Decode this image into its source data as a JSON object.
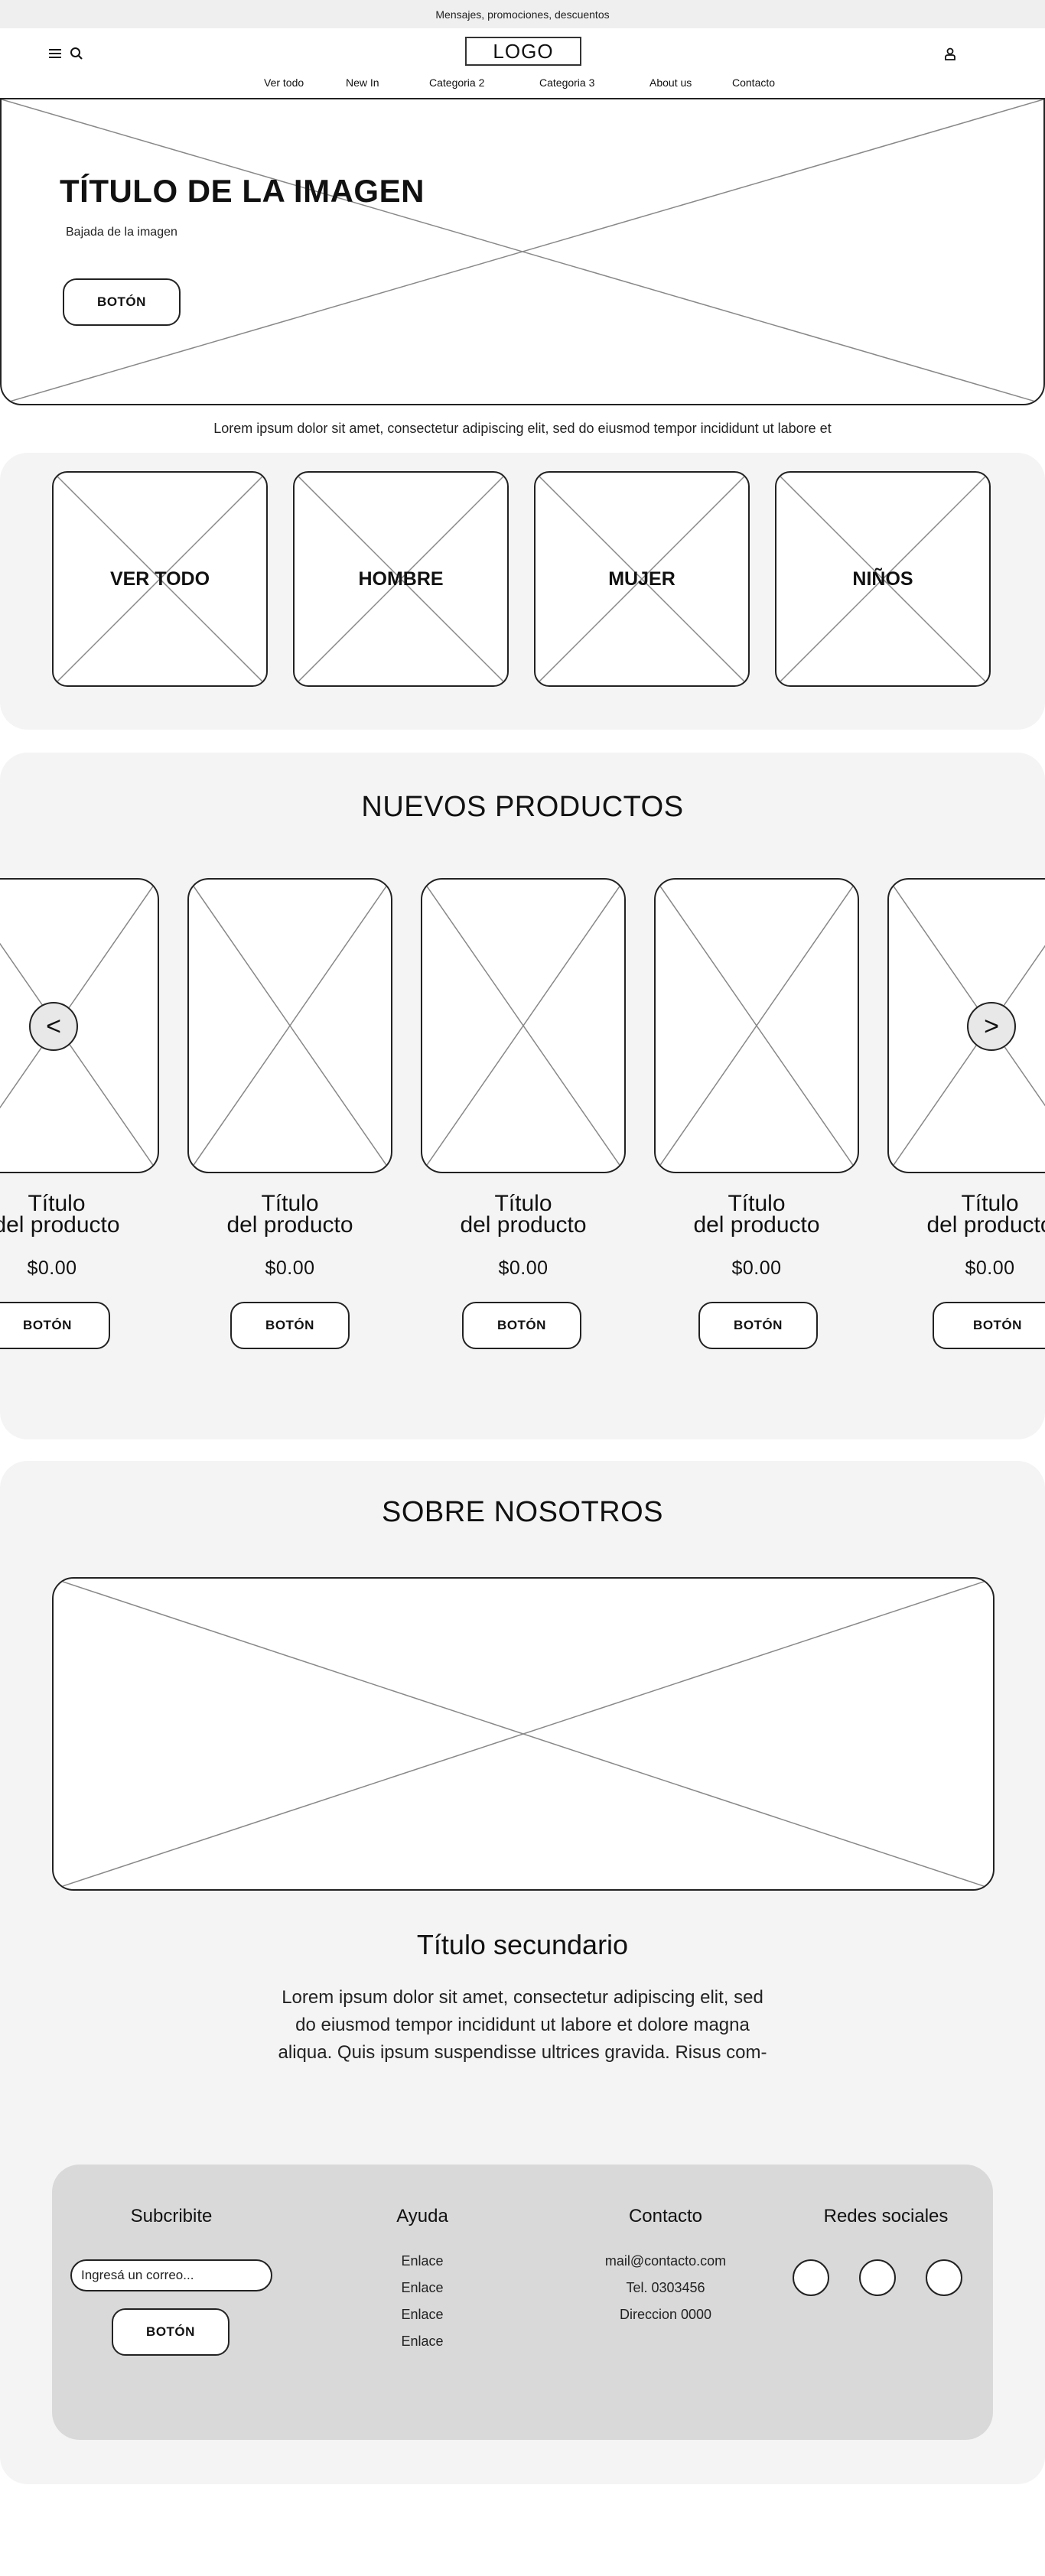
{
  "promo_bar": {
    "text": "Mensajes, promociones, descuentos"
  },
  "header": {
    "logo": "LOGO",
    "icons": {
      "menu": "menu-icon",
      "search": "search-icon",
      "user": "user-icon"
    }
  },
  "nav": {
    "items": [
      {
        "label": "Ver todo"
      },
      {
        "label": "New In"
      },
      {
        "label": "Categoria 2"
      },
      {
        "label": "Categoria 3"
      },
      {
        "label": "About us"
      },
      {
        "label": "Contacto"
      }
    ]
  },
  "hero": {
    "title": "TÍTULO DE LA IMAGEN",
    "subtitle": "Bajada de la imagen",
    "button": "BOTÓN"
  },
  "tagline": "Lorem ipsum dolor sit amet, consectetur adipiscing elit, sed do eiusmod tempor incididunt ut labore et",
  "categories": [
    {
      "label": "VER TODO"
    },
    {
      "label": "HOMBRE"
    },
    {
      "label": "MUJER"
    },
    {
      "label": "NIÑOS"
    }
  ],
  "products": {
    "title": "NUEVOS PRODUCTOS",
    "prev": "<",
    "next": ">",
    "items": [
      {
        "title_1": "Título",
        "title_2": "del producto",
        "price": "$0.00",
        "button": "BOTÓN"
      },
      {
        "title_1": "Título",
        "title_2": "del producto",
        "price": "$0.00",
        "button": "BOTÓN"
      },
      {
        "title_1": "Título",
        "title_2": "del producto",
        "price": "$0.00",
        "button": "BOTÓN"
      },
      {
        "title_1": "Título",
        "title_2": "del producto",
        "price": "$0.00",
        "button": "BOTÓN"
      },
      {
        "title_1": "Título",
        "title_2": "del producto",
        "price": "$0.00",
        "button": "BOTÓN"
      }
    ]
  },
  "about": {
    "title": "SOBRE NOSOTROS",
    "subtitle": "Título secundario",
    "body_lines": [
      "Lorem ipsum dolor sit amet, consectetur adipiscing elit, sed",
      "do eiusmod tempor incididunt ut labore et dolore magna",
      "aliqua. Quis ipsum suspendisse ultrices gravida. Risus com-"
    ]
  },
  "footer": {
    "subscribe": {
      "title": "Subcribite",
      "placeholder": "Ingresá un correo...",
      "button": "BOTÓN"
    },
    "help": {
      "title": "Ayuda",
      "links": [
        "Enlace",
        "Enlace",
        "Enlace",
        "Enlace"
      ]
    },
    "contact": {
      "title": "Contacto",
      "lines": [
        "mail@contacto.com",
        "Tel. 0303456",
        "Direccion 0000"
      ]
    },
    "social": {
      "title": "Redes sociales",
      "count": 3
    }
  }
}
